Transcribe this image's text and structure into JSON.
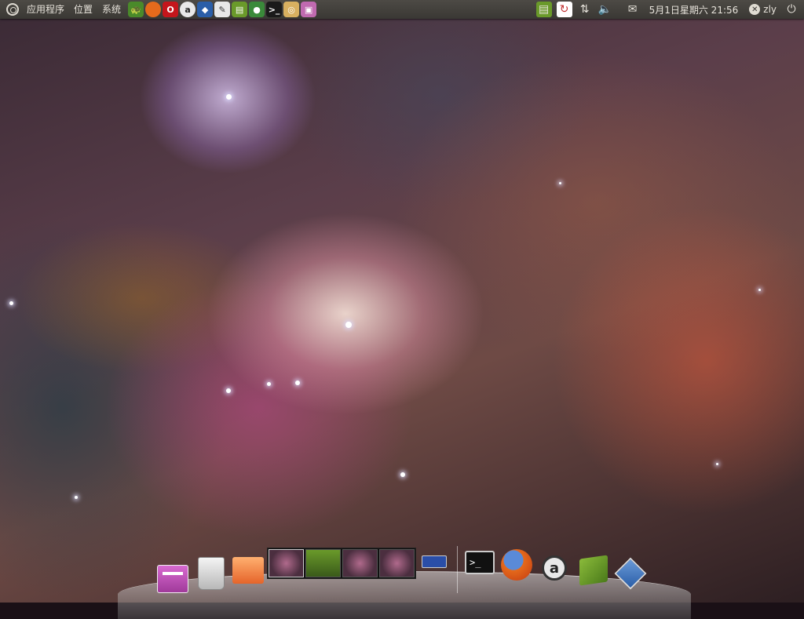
{
  "panel": {
    "menus": [
      "应用程序",
      "位置",
      "系统"
    ],
    "launchers": [
      {
        "name": "tortoise-icon",
        "glyph": "🐢",
        "color": "#4a8a2a"
      },
      {
        "name": "firefox-icon",
        "glyph": "",
        "color": "#e56a1c"
      },
      {
        "name": "opera-icon",
        "glyph": "O",
        "color": "#c4161c"
      },
      {
        "name": "amazon-icon",
        "glyph": "a",
        "color": "#2a2a2a"
      },
      {
        "name": "virtualbox-icon",
        "glyph": "◆",
        "color": "#2a5ea8"
      },
      {
        "name": "text-editor-icon",
        "glyph": "✎",
        "color": "#e8e8e8"
      },
      {
        "name": "books-icon",
        "glyph": "▤",
        "color": "#6a9a2a"
      },
      {
        "name": "chrome-icon",
        "glyph": "●",
        "color": "#3a8a3a"
      },
      {
        "name": "terminal-icon",
        "glyph": ">_",
        "color": "#1a1a1a"
      },
      {
        "name": "disc-burner-icon",
        "glyph": "◎",
        "color": "#d8b060"
      },
      {
        "name": "screenshot-icon",
        "glyph": "▣",
        "color": "#c06ab0"
      }
    ],
    "clock": "5月1日星期六 21:56",
    "user": "zly"
  },
  "dock": {
    "left_items": [
      "file-manager-icon",
      "trash-icon",
      "home-folder-icon"
    ],
    "right_items": [
      "terminal-icon",
      "firefox-icon",
      "amazon-icon",
      "books-icon",
      "virtualbox-icon"
    ]
  }
}
